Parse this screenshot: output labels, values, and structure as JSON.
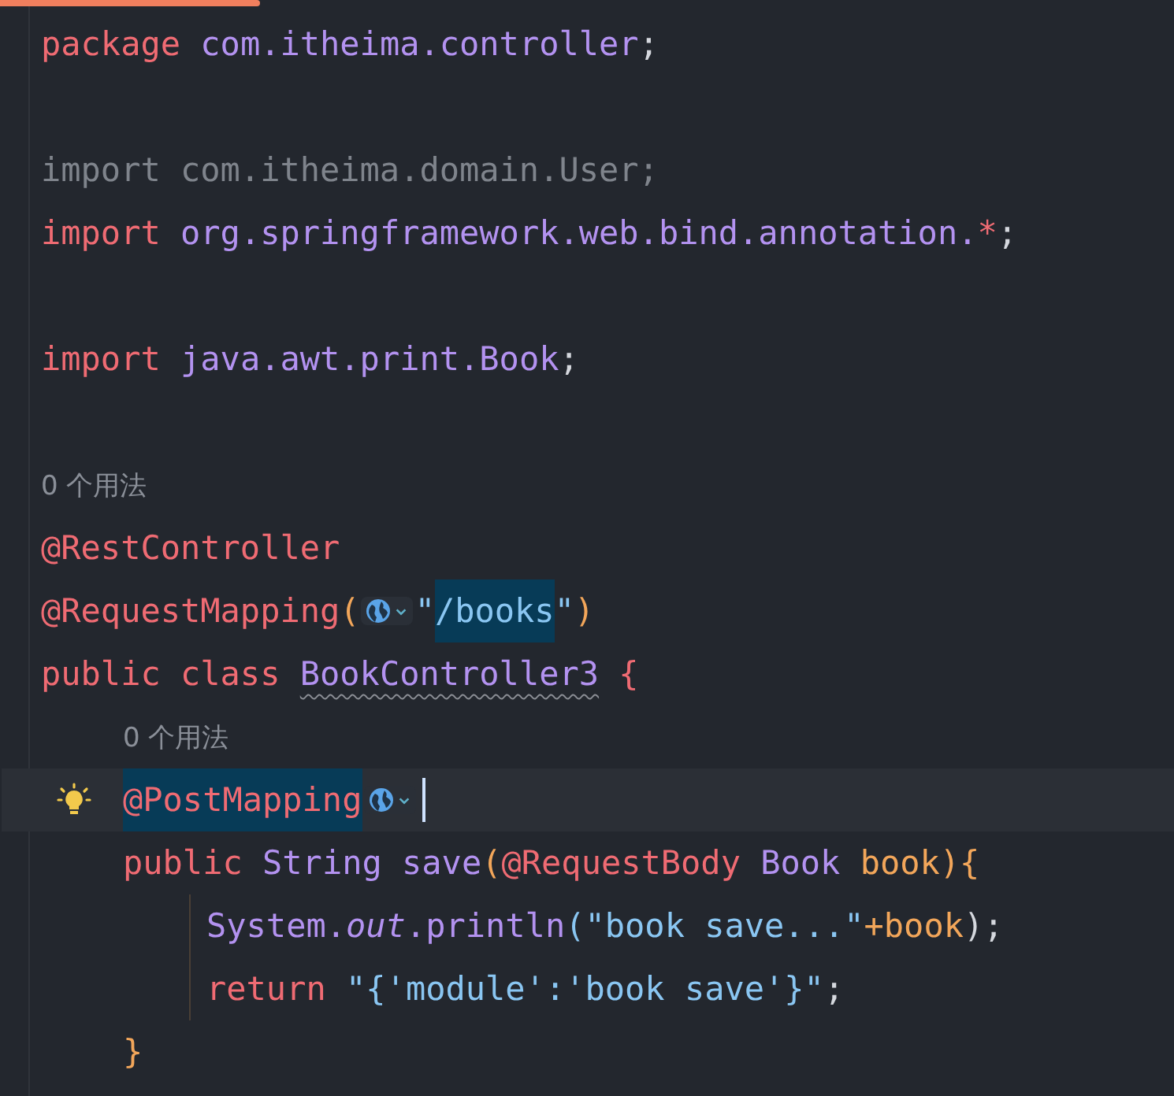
{
  "editor": {
    "lines": [
      {
        "kind": "code",
        "current": false,
        "tokens": [
          {
            "text": "package ",
            "kind": "keyword"
          },
          {
            "text": "com.itheima.controller",
            "kind": "type"
          },
          {
            "text": ";",
            "kind": "plain"
          }
        ]
      },
      {
        "kind": "blank",
        "current": false
      },
      {
        "kind": "code",
        "current": false,
        "tokens": [
          {
            "text": "import com.itheima.domain.User;",
            "kind": "unused"
          }
        ]
      },
      {
        "kind": "code",
        "current": false,
        "tokens": [
          {
            "text": "import ",
            "kind": "keyword"
          },
          {
            "text": "org.springframework.web.bind.annotation.",
            "kind": "type"
          },
          {
            "text": "*",
            "kind": "keyword"
          },
          {
            "text": ";",
            "kind": "plain"
          }
        ]
      },
      {
        "kind": "blank",
        "current": false
      },
      {
        "kind": "code",
        "current": false,
        "tokens": [
          {
            "text": "import ",
            "kind": "keyword"
          },
          {
            "text": "java.awt.print.Book",
            "kind": "type"
          },
          {
            "text": ";",
            "kind": "plain"
          }
        ]
      },
      {
        "kind": "blank",
        "current": false
      },
      {
        "kind": "hint",
        "current": false,
        "text": "0 个用法"
      },
      {
        "kind": "code",
        "current": false,
        "tokens": [
          {
            "text": "@RestController",
            "kind": "annotation"
          }
        ]
      },
      {
        "kind": "code",
        "current": false,
        "tokens": [
          {
            "text": "@RequestMapping",
            "kind": "annotation"
          },
          {
            "text": "(",
            "kind": "param"
          },
          {
            "kind": "url-inlay"
          },
          {
            "text": "\"",
            "kind": "string"
          },
          {
            "text": "/books",
            "kind": "string-match"
          },
          {
            "text": "\"",
            "kind": "string"
          },
          {
            "text": ")",
            "kind": "param"
          }
        ]
      },
      {
        "kind": "code",
        "current": false,
        "tokens": [
          {
            "text": "public class ",
            "kind": "keyword"
          },
          {
            "text": "BookController3",
            "kind": "type-warning"
          },
          {
            "text": " {",
            "kind": "keyword"
          }
        ],
        "children": [
          {
            "kind": "hint",
            "current": false,
            "text": "0 个用法"
          },
          {
            "kind": "code",
            "current": true,
            "bulb": true,
            "tokens": [
              {
                "text": "@PostMapping",
                "kind": "annotation-match"
              },
              {
                "kind": "url-inlay"
              },
              {
                "kind": "caret"
              }
            ]
          },
          {
            "kind": "code",
            "current": false,
            "tokens": [
              {
                "text": "public ",
                "kind": "keyword"
              },
              {
                "text": "String save",
                "kind": "type"
              },
              {
                "text": "(",
                "kind": "param"
              },
              {
                "text": "@RequestBody ",
                "kind": "annotation"
              },
              {
                "text": "Book ",
                "kind": "type"
              },
              {
                "text": "book){",
                "kind": "param"
              }
            ],
            "children": [
              {
                "kind": "code",
                "current": false,
                "tokens": [
                  {
                    "text": "System.",
                    "kind": "type"
                  },
                  {
                    "text": "out",
                    "kind": "field"
                  },
                  {
                    "text": ".println",
                    "kind": "type"
                  },
                  {
                    "text": "(\"book save...\"",
                    "kind": "string"
                  },
                  {
                    "text": "+book",
                    "kind": "param"
                  },
                  {
                    "text": ");",
                    "kind": "plain"
                  }
                ]
              },
              {
                "kind": "code",
                "current": false,
                "tokens": [
                  {
                    "text": "return ",
                    "kind": "keyword"
                  },
                  {
                    "text": "\"{'module':'book save'}\"",
                    "kind": "string"
                  },
                  {
                    "text": ";",
                    "kind": "plain"
                  }
                ]
              }
            ]
          },
          {
            "kind": "code",
            "current": false,
            "tokens": [
              {
                "text": "}",
                "kind": "param"
              }
            ]
          }
        ]
      }
    ]
  }
}
